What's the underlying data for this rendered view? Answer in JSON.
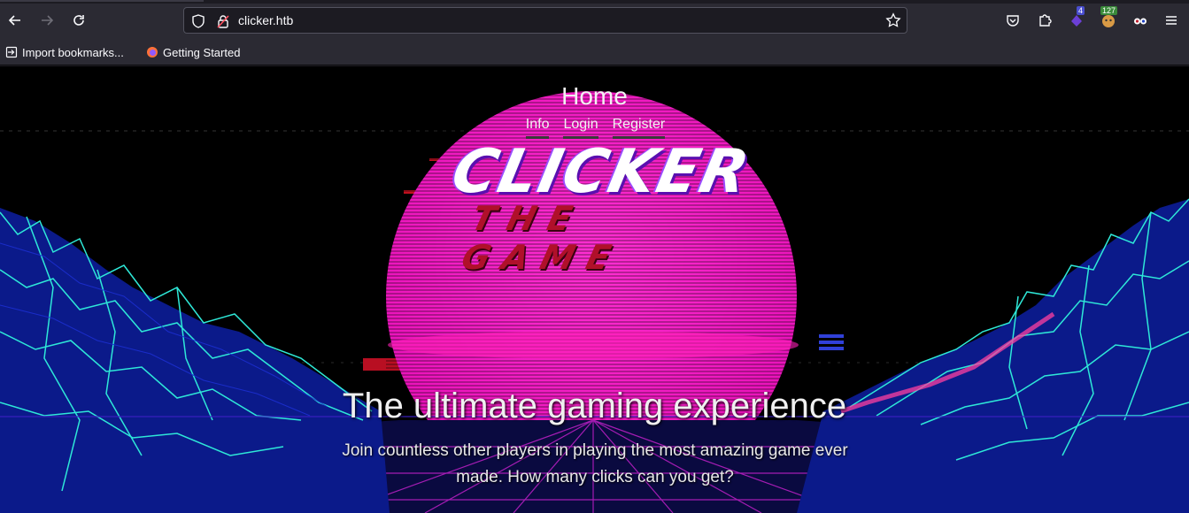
{
  "browser": {
    "url": "clicker.htb",
    "extension_badges": {
      "ext1": "4",
      "ext2": "127"
    },
    "bookmarks": [
      {
        "label": "Import bookmarks...",
        "icon": "import-icon"
      },
      {
        "label": "Getting Started",
        "icon": "firefox-icon"
      }
    ]
  },
  "page": {
    "title": "Home",
    "nav": {
      "info": "Info",
      "login": "Login",
      "register": "Register"
    },
    "logo": {
      "main": "CLICKER",
      "sub": "THE GAME"
    },
    "headline": "The ultimate gaming experience",
    "subtext": "Join countless other players in playing the most amazing game ever made. How many clicks can you get?"
  },
  "colors": {
    "sun": "#ff14c8",
    "grid_cyan": "#1fe0d0",
    "grid_blue": "#1a2bb8",
    "chrome": "#2b2a33"
  }
}
